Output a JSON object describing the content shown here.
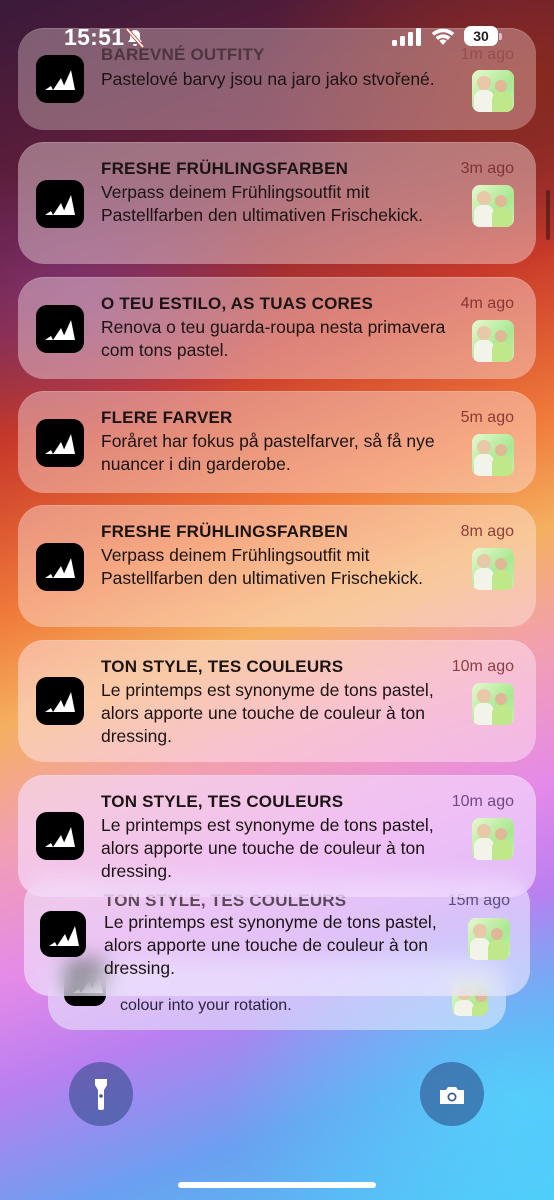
{
  "status_bar": {
    "time": "15:51",
    "battery": "30"
  },
  "notifications": [
    {
      "title": "BAREVNÉ OUTFITY",
      "body": "Pastelové barvy jsou na jaro jako stvořené.",
      "ago": "1m ago"
    },
    {
      "title": "FRESHE FRÜHLINGSFARBEN",
      "body": "Verpass deinem Frühlingsoutfit mit Pastellfarben den ultimativen Frischekick.",
      "ago": "3m ago"
    },
    {
      "title": "O TEU ESTILO, AS TUAS CORES",
      "body": "Renova o teu guarda-roupa nesta primavera com tons pastel.",
      "ago": "4m ago"
    },
    {
      "title": "FLERE FARVER",
      "body": "Foråret har fokus på pastelfarver, så få nye nuancer i din garderobe.",
      "ago": "5m ago"
    },
    {
      "title": "FRESHE FRÜHLINGSFARBEN",
      "body": "Verpass deinem Frühlingsoutfit mit Pastellfarben den ultimativen Frischekick.",
      "ago": "8m ago"
    },
    {
      "title": "TON STYLE, TES COULEURS",
      "body": "Le printemps est synonyme de tons pastel, alors apporte une touche de couleur à ton dressing.",
      "ago": "10m ago"
    },
    {
      "title": "TON STYLE, TES COULEURS",
      "body": "Le printemps est synonyme de tons pastel, alors apporte une touche de couleur à ton dressing.",
      "ago": "10m ago"
    },
    {
      "title": "TON STYLE, TES COULEURS",
      "body": "Le printemps est synonyme de tons pastel, alors apporte une touche de couleur à ton dressing.",
      "ago": "15m ago"
    },
    {
      "title": "",
      "body": "colour into your rotation.",
      "ago": ""
    }
  ],
  "icons": {
    "app": "adidas-logo-icon",
    "left_button": "flashlight-icon",
    "right_button": "camera-icon"
  }
}
